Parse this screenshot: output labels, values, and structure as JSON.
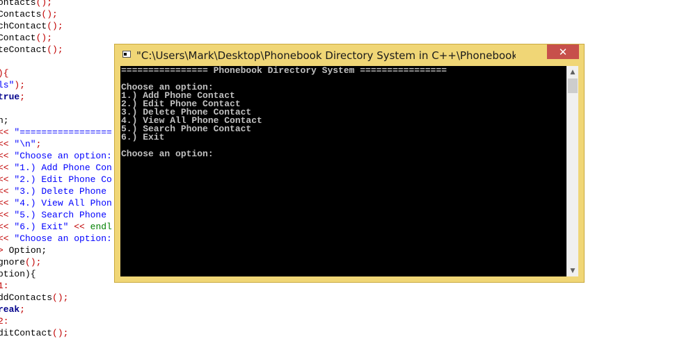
{
  "editor": {
    "lines": [
      [
        {
          "t": "ontacts",
          "c": "plain"
        },
        {
          "t": "();",
          "c": "sym"
        }
      ],
      [
        {
          "t": "Contacts",
          "c": "plain"
        },
        {
          "t": "();",
          "c": "sym"
        }
      ],
      [
        {
          "t": "chContact",
          "c": "plain"
        },
        {
          "t": "();",
          "c": "sym"
        }
      ],
      [
        {
          "t": "Contact",
          "c": "plain"
        },
        {
          "t": "();",
          "c": "sym"
        }
      ],
      [
        {
          "t": "teContact",
          "c": "plain"
        },
        {
          "t": "();",
          "c": "sym"
        }
      ],
      [
        {
          "t": "",
          "c": "plain"
        }
      ],
      [
        {
          "t": "){",
          "c": "sym"
        }
      ],
      [
        {
          "t": "ls\"",
          "c": "str"
        },
        {
          "t": ");",
          "c": "sym"
        }
      ],
      [
        {
          "t": "true",
          "c": "kw"
        },
        {
          "t": ";",
          "c": "sym"
        }
      ],
      [
        {
          "t": "",
          "c": "plain"
        }
      ],
      [
        {
          "t": "n;",
          "c": "plain"
        }
      ],
      [
        {
          "t": "<< ",
          "c": "sym"
        },
        {
          "t": "\"=================",
          "c": "str"
        }
      ],
      [
        {
          "t": "<< ",
          "c": "sym"
        },
        {
          "t": "\"\\n\"",
          "c": "str"
        },
        {
          "t": ";",
          "c": "sym"
        }
      ],
      [
        {
          "t": "<< ",
          "c": "sym"
        },
        {
          "t": "\"Choose an option:",
          "c": "str"
        }
      ],
      [
        {
          "t": "<< ",
          "c": "sym"
        },
        {
          "t": "\"1.) Add Phone Con",
          "c": "str"
        }
      ],
      [
        {
          "t": "<< ",
          "c": "sym"
        },
        {
          "t": "\"2.) Edit Phone Co",
          "c": "str"
        }
      ],
      [
        {
          "t": "<< ",
          "c": "sym"
        },
        {
          "t": "\"3.) Delete Phone ",
          "c": "str"
        }
      ],
      [
        {
          "t": "<< ",
          "c": "sym"
        },
        {
          "t": "\"4.) View All Phon",
          "c": "str"
        }
      ],
      [
        {
          "t": "<< ",
          "c": "sym"
        },
        {
          "t": "\"5.) Search Phone ",
          "c": "str"
        }
      ],
      [
        {
          "t": "<< ",
          "c": "sym"
        },
        {
          "t": "\"6.) Exit\" ",
          "c": "str"
        },
        {
          "t": "<< ",
          "c": "sym"
        },
        {
          "t": "endl",
          "c": "endl"
        }
      ],
      [
        {
          "t": "<< ",
          "c": "sym"
        },
        {
          "t": "\"Choose an option:",
          "c": "str"
        }
      ],
      [
        {
          "t": "> ",
          "c": "sym"
        },
        {
          "t": "Option;",
          "c": "plain"
        }
      ],
      [
        {
          "t": "gnore",
          "c": "plain"
        },
        {
          "t": "();",
          "c": "sym"
        }
      ],
      [
        {
          "t": "ption){",
          "c": "plain"
        }
      ],
      [
        {
          "t": "1:",
          "c": "sym"
        }
      ],
      [
        {
          "t": "ddContacts",
          "c": "plain"
        },
        {
          "t": "();",
          "c": "sym"
        }
      ],
      [
        {
          "t": "reak",
          "c": "kw"
        },
        {
          "t": ";",
          "c": "sym"
        }
      ],
      [
        {
          "t": "2:",
          "c": "sym"
        }
      ],
      [
        {
          "t": "ditContact",
          "c": "plain"
        },
        {
          "t": "();",
          "c": "sym"
        }
      ]
    ]
  },
  "window": {
    "title": "\"C:\\Users\\Mark\\Desktop\\Phonebook Directory System in C++\\Phonebook Directory System.exe\"",
    "close_label": "✕"
  },
  "console": {
    "lines": [
      "================ Phonebook Directory System ================",
      "",
      "Choose an option:",
      "1.) Add Phone Contact",
      "2.) Edit Phone Contact",
      "3.) Delete Phone Contact",
      "4.) View All Phone Contact",
      "5.) Search Phone Contact",
      "6.) Exit",
      "",
      "Choose an option: "
    ]
  },
  "scrollbar": {
    "up_arrow": "▲",
    "down_arrow": "▼"
  }
}
